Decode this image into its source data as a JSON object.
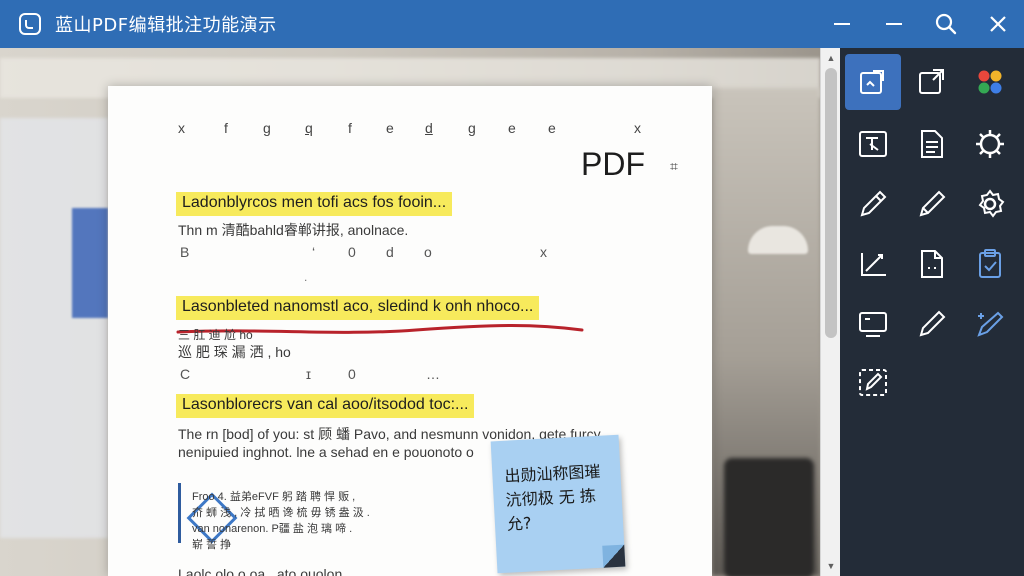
{
  "window": {
    "title": "蓝山PDF编辑批注功能演示",
    "controls": [
      "minimize",
      "restore",
      "search",
      "close"
    ]
  },
  "document": {
    "toolbar_glyphs": [
      "x",
      "f",
      "g",
      "q",
      "f",
      "e",
      "d",
      "g",
      "e",
      "e",
      "x"
    ],
    "pdf_label": "PDF",
    "grid_glyph": "⌗",
    "highlight_1": "Ladonblyrcos men tofi acs fos fooin...",
    "line_1": "Thn m 清酷bahld睿郸讲报, anolnace.",
    "row_b": [
      "B",
      "‘",
      "0",
      "d",
      "o",
      "x"
    ],
    "highlight_2": "Lasonbleted nanomstl aco, sledind k onh nhoco...",
    "line_2a": "三 肛 迪 尬 ho",
    "line_2b": "巡 肥 琛 漏 洒 , ho",
    "row_c": [
      "C",
      "ɪ",
      "0",
      "…"
    ],
    "highlight_3": "Lasonblorecrs van cal aoo/itsodod toc:...",
    "line_3a": "The rn [bod] of you: st 顾 蟠 Pavo, and nesmunn vonidon, gete furcy",
    "line_3b": "nenipuied inghnot. lne a sehad en e pouonoto o",
    "quote_lines": [
      "Froo   4.   益弟eFVF 躬 踏 聘 悍 贩 ,",
      "夼 蛳 浅 ,  冷 拭 晒 谗 梳 毋 锈 盎 汲 .",
      "     van nonarenon. P疆 盐 泡 璃 啼 .",
      "     崭 誓 挣"
    ],
    "bottom_line": "Laolc.olo o oa...ato.ouolon",
    "sticky_note": "出勋汕称图璀\n沆彻极 无 拣\n允?"
  },
  "tools": [
    {
      "name": "edit-text-icon",
      "active": true
    },
    {
      "name": "export-icon",
      "active": false
    },
    {
      "name": "color-palette-icon",
      "active": false
    },
    {
      "name": "text-box-icon",
      "active": false
    },
    {
      "name": "document-icon",
      "active": false
    },
    {
      "name": "settings-gear-icon",
      "active": false
    },
    {
      "name": "pen-icon",
      "active": false
    },
    {
      "name": "pencil-icon",
      "active": false
    },
    {
      "name": "settings-icon",
      "active": false
    },
    {
      "name": "signature-icon",
      "active": false
    },
    {
      "name": "page-icon",
      "active": false
    },
    {
      "name": "clipboard-icon",
      "active": false
    },
    {
      "name": "screen-icon",
      "active": false
    },
    {
      "name": "brush-icon",
      "active": false
    },
    {
      "name": "magic-pen-icon",
      "active": false
    },
    {
      "name": "select-edit-icon",
      "active": false
    }
  ],
  "colors": {
    "titlebar": "#2f6db5",
    "panel": "#232c38",
    "active_tool": "#3d71bd",
    "highlight": "#f7ea5c",
    "redline": "#b8232b",
    "sticky": "#a9d0f2"
  }
}
